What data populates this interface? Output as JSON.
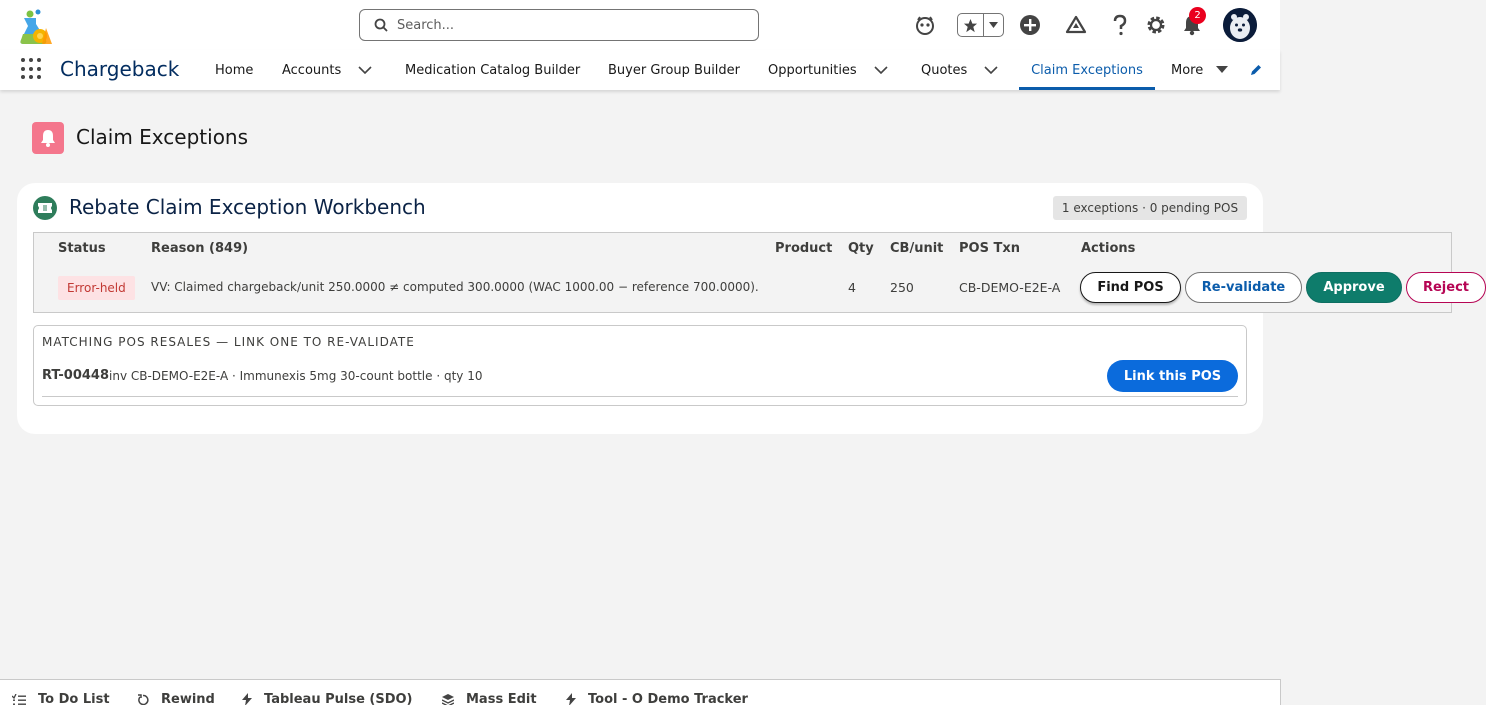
{
  "search": {
    "placeholder": "Search..."
  },
  "header": {
    "notification_count": "2"
  },
  "nav": {
    "app_name": "Chargeback",
    "items": [
      "Home",
      "Accounts",
      "Medication Catalog Builder",
      "Buyer Group Builder",
      "Opportunities",
      "Quotes",
      "Claim Exceptions",
      "More"
    ],
    "active": "Claim Exceptions"
  },
  "page": {
    "title": "Claim Exceptions"
  },
  "card": {
    "title": "Rebate Claim Exception Workbench",
    "badge": "1 exceptions · 0 pending POS",
    "columns": [
      "Status",
      "Reason (849)",
      "Product",
      "Qty",
      "CB/unit",
      "POS Txn",
      "Actions"
    ],
    "row": {
      "status": "Error-held",
      "reason": "VV: Claimed chargeback/unit 250.0000 ≠ computed 300.0000 (WAC 1000.00 − reference 700.0000).",
      "product": "",
      "qty": "4",
      "cb_unit": "250",
      "pos_txn": "CB-DEMO-E2E-A",
      "actions": [
        "Find POS",
        "Re-validate",
        "Approve",
        "Reject"
      ]
    },
    "pos_panel": {
      "heading": "MATCHING POS RESALES — LINK ONE TO RE-VALIDATE",
      "resale_id": "RT-00448",
      "resale_desc": "inv CB-DEMO-E2E-A · Immunexis 5mg 30-count bottle · qty 10",
      "link_label": "Link this POS"
    }
  },
  "utility_bar": [
    "To Do List",
    "Rewind",
    "Tableau Pulse (SDO)",
    "Mass Edit",
    "Tool - O Demo Tracker"
  ],
  "colors": {
    "brand": "#0b5cab",
    "page_icon": "#f4768c",
    "approve": "#0e7c6b",
    "reject": "#b60554",
    "error": "#c23934"
  }
}
